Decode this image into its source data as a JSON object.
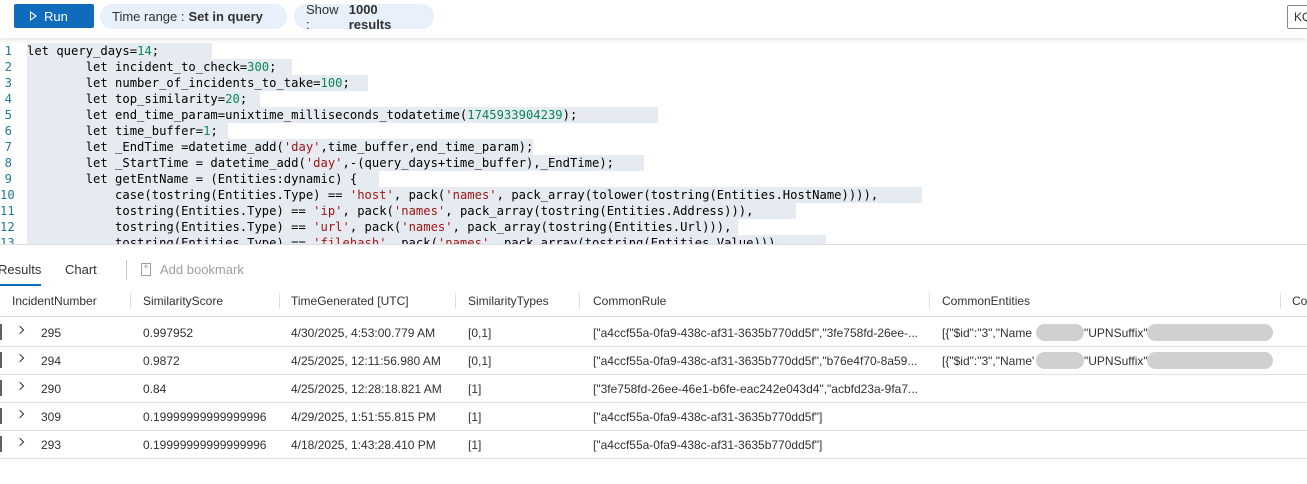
{
  "toolbar": {
    "run_label": "Run",
    "time_range_label": "Time range :",
    "time_range_value": "Set in query",
    "show_label": "Show :",
    "show_value": "1000 results",
    "query_lang_value": "KQ"
  },
  "editor": {
    "lines": [
      {
        "n": "1",
        "segs": [
          {
            "t": "let query_days=",
            "c": ""
          },
          {
            "t": "14",
            "c": "num"
          },
          {
            "t": ";",
            "c": ""
          }
        ]
      },
      {
        "n": "2",
        "segs": [
          {
            "t": "        let incident_to_check=",
            "c": ""
          },
          {
            "t": "300",
            "c": "num"
          },
          {
            "t": ";",
            "c": ""
          }
        ]
      },
      {
        "n": "3",
        "segs": [
          {
            "t": "        let number_of_incidents_to_take=",
            "c": ""
          },
          {
            "t": "100",
            "c": "num"
          },
          {
            "t": ";",
            "c": ""
          }
        ]
      },
      {
        "n": "4",
        "segs": [
          {
            "t": "        let top_similarity=",
            "c": ""
          },
          {
            "t": "20",
            "c": "num"
          },
          {
            "t": ";",
            "c": ""
          }
        ]
      },
      {
        "n": "5",
        "segs": [
          {
            "t": "        let end_time_param=unixtime_milliseconds_todatetime(",
            "c": ""
          },
          {
            "t": "1745933904239",
            "c": "num"
          },
          {
            "t": ");",
            "c": ""
          }
        ]
      },
      {
        "n": "6",
        "segs": [
          {
            "t": "        let time_buffer=",
            "c": ""
          },
          {
            "t": "1",
            "c": "num"
          },
          {
            "t": ";",
            "c": ""
          }
        ]
      },
      {
        "n": "7",
        "segs": [
          {
            "t": "        let _EndTime =datetime_add(",
            "c": ""
          },
          {
            "t": "'day'",
            "c": "str"
          },
          {
            "t": ",time_buffer,end_time_param);",
            "c": ""
          }
        ]
      },
      {
        "n": "8",
        "segs": [
          {
            "t": "        let _StartTime = datetime_add(",
            "c": ""
          },
          {
            "t": "'day'",
            "c": "str"
          },
          {
            "t": ",-(query_days+time_buffer),_EndTime);",
            "c": ""
          }
        ]
      },
      {
        "n": "9",
        "segs": [
          {
            "t": "        let getEntName = (Entities:dynamic) {",
            "c": ""
          }
        ]
      },
      {
        "n": "10",
        "segs": [
          {
            "t": "            case(tostring(Entities.Type) == ",
            "c": ""
          },
          {
            "t": "'host'",
            "c": "str"
          },
          {
            "t": ", pack(",
            "c": ""
          },
          {
            "t": "'names'",
            "c": "str"
          },
          {
            "t": ", pack_array(tolower(tostring(Entities.HostName)))),",
            "c": ""
          }
        ]
      },
      {
        "n": "11",
        "segs": [
          {
            "t": "            tostring(Entities.Type) == ",
            "c": ""
          },
          {
            "t": "'ip'",
            "c": "str"
          },
          {
            "t": ", pack(",
            "c": ""
          },
          {
            "t": "'names'",
            "c": "str"
          },
          {
            "t": ", pack_array(tostring(Entities.Address))),",
            "c": ""
          }
        ]
      },
      {
        "n": "12",
        "segs": [
          {
            "t": "            tostring(Entities.Type) == ",
            "c": ""
          },
          {
            "t": "'url'",
            "c": "str"
          },
          {
            "t": ", pack(",
            "c": ""
          },
          {
            "t": "'names'",
            "c": "str"
          },
          {
            "t": ", pack_array(tostring(Entities.Url))),",
            "c": ""
          }
        ]
      },
      {
        "n": "13",
        "segs": [
          {
            "t": "            tostring(Entities.Type) == ",
            "c": ""
          },
          {
            "t": "'filehash'",
            "c": "str"
          },
          {
            "t": ", pack(",
            "c": ""
          },
          {
            "t": "'names'",
            "c": "str"
          },
          {
            "t": ", pack_array(tostring(Entities.Value))),",
            "c": ""
          }
        ]
      }
    ]
  },
  "results": {
    "tabs": [
      "Results",
      "Chart"
    ],
    "add_bookmark_label": "Add bookmark",
    "columns": [
      "IncidentNumber",
      "SimilarityScore",
      "TimeGenerated [UTC]",
      "SimilarityTypes",
      "CommonRule",
      "CommonEntities",
      "Co"
    ],
    "rows": [
      [
        "295",
        "0.997952",
        "4/30/2025, 4:53:00.779 AM",
        "[0,1]",
        "[\"a4ccf55a-0fa9-438c-af31-3635b770dd5f\",\"3fe758fd-26ee-...",
        "[{\"$id\":\"3\",\"Name",
        "\"UPNSuffix\""
      ],
      [
        "294",
        "0.9872",
        "4/25/2025, 12:11:56.980 AM",
        "[0,1]",
        "[\"a4ccf55a-0fa9-438c-af31-3635b770dd5f\",\"b76e4f70-8a59...",
        "[{\"$id\":\"3\",\"Name'",
        "\"UPNSuffix\""
      ],
      [
        "290",
        "0.84",
        "4/25/2025, 12:28:18.821 AM",
        "[1]",
        "[\"3fe758fd-26ee-46e1-b6fe-eac242e043d4\",\"acbfd23a-9fa7...",
        "",
        ""
      ],
      [
        "309",
        "0.19999999999999996",
        "4/29/2025, 1:51:55.815 PM",
        "[1]",
        "[\"a4ccf55a-0fa9-438c-af31-3635b770dd5f\"]",
        "",
        ""
      ],
      [
        "293",
        "0.19999999999999996",
        "4/18/2025, 1:43:28.410 PM",
        "[1]",
        "[\"a4ccf55a-0fa9-438c-af31-3635b770dd5f\"]",
        "",
        ""
      ]
    ]
  }
}
